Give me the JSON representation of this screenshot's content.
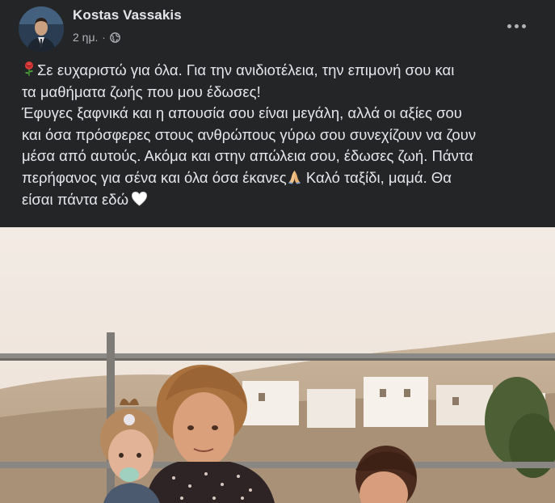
{
  "post": {
    "author": {
      "name": "Kostas Vassakis"
    },
    "time": "2 ημ.",
    "separator": "·",
    "privacy_icon": "globe-icon",
    "more_icon": "more-options-icon",
    "text_lines": [
      "Σε ευχαριστώ για όλα. Για την ανιδιοτέλεια, την επιμονή σου και",
      "τα μαθήματα ζωής που μου έδωσες!",
      "Έφυγες ξαφνικά και η απουσία σου είναι μεγάλη, αλλά οι αξίες σου",
      "και όσα πρόσφερες στους ανθρώπους γύρω σου συνεχίζουν να ζουν",
      "μέσα από αυτούς. Ακόμα και στην απώλεια σου, έδωσες ζωή. Πάντα",
      "περήφανος για σένα και όλα όσα έκανες",
      "Καλό ταξίδι, μαμά. Θα",
      "είσαι πάντα εδώ"
    ],
    "emojis": {
      "rose": "rose-icon",
      "pray": "folded-hands-icon",
      "heart": "white-heart-icon"
    },
    "colors": {
      "background": "#242526",
      "primary_text": "#e4e6eb",
      "secondary_text": "#b0b3b8"
    }
  }
}
